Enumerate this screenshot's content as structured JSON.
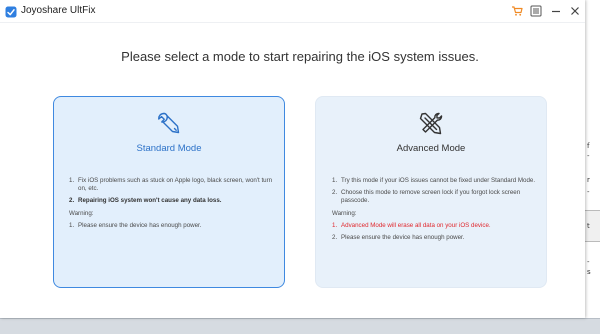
{
  "window": {
    "title": "Joyoshare UltFix"
  },
  "headline": "Please select a mode to start repairing the iOS system issues.",
  "colors": {
    "accent_blue": "#3f89e0",
    "cart_orange": "#f08a24",
    "warning_red": "#e0282d",
    "selected_card_bg": "#e2effc"
  },
  "icons": {
    "cart": "cart-icon",
    "menu": "menu-icon",
    "minimize": "minimize-icon",
    "close": "close-icon",
    "standard": "wrench-icon",
    "advanced": "tools-icon"
  },
  "standard_mode": {
    "title": "Standard Mode",
    "items": [
      {
        "num": "1.",
        "text": "Fix iOS problems such as stuck on Apple logo, black screen, won't turn on, etc."
      },
      {
        "num": "2.",
        "text": "Repairing iOS system won't cause any data loss."
      }
    ],
    "warning_label": "Warning:",
    "warnings": [
      {
        "num": "1.",
        "text": "Please ensure the device has enough power."
      }
    ]
  },
  "advanced_mode": {
    "title": "Advanced Mode",
    "items": [
      {
        "num": "1.",
        "text": "Try this mode if your iOS issues cannot be fixed under Standard Mode."
      },
      {
        "num": "2.",
        "text": "Choose this mode to remove screen lock if you forgot lock screen passcode."
      }
    ],
    "warning_label": "Warning:",
    "warnings": [
      {
        "num": "1.",
        "text": "Advanced Mode will erase all data on your iOS device."
      },
      {
        "num": "2.",
        "text": "Please ensure the device has enough power."
      }
    ]
  },
  "background_fragments": [
    "f",
    "-",
    "r",
    "-",
    "t",
    "-",
    "s"
  ]
}
